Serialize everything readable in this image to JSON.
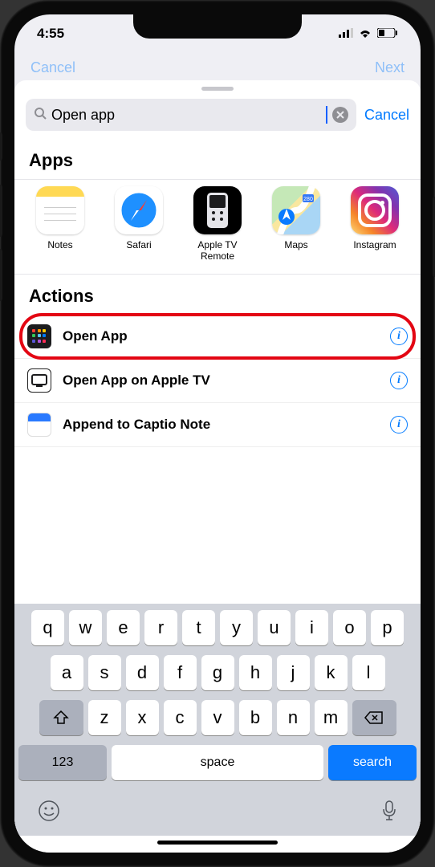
{
  "status": {
    "time": "4:55"
  },
  "backdrop": {
    "left": "Cancel",
    "right": "Next"
  },
  "search": {
    "value": "Open app",
    "cancel": "Cancel"
  },
  "sections": {
    "apps_title": "Apps",
    "actions_title": "Actions"
  },
  "apps": [
    {
      "label": "Notes"
    },
    {
      "label": "Safari"
    },
    {
      "label": "Apple TV Remote"
    },
    {
      "label": "Maps"
    },
    {
      "label": "Instagram"
    }
  ],
  "actions": [
    {
      "label": "Open App"
    },
    {
      "label": "Open App on Apple TV"
    },
    {
      "label": "Append to Captio Note"
    }
  ],
  "keyboard": {
    "row1": [
      "q",
      "w",
      "e",
      "r",
      "t",
      "y",
      "u",
      "i",
      "o",
      "p"
    ],
    "row2": [
      "a",
      "s",
      "d",
      "f",
      "g",
      "h",
      "j",
      "k",
      "l"
    ],
    "row3": [
      "z",
      "x",
      "c",
      "v",
      "b",
      "n",
      "m"
    ],
    "num": "123",
    "space": "space",
    "search": "search"
  }
}
